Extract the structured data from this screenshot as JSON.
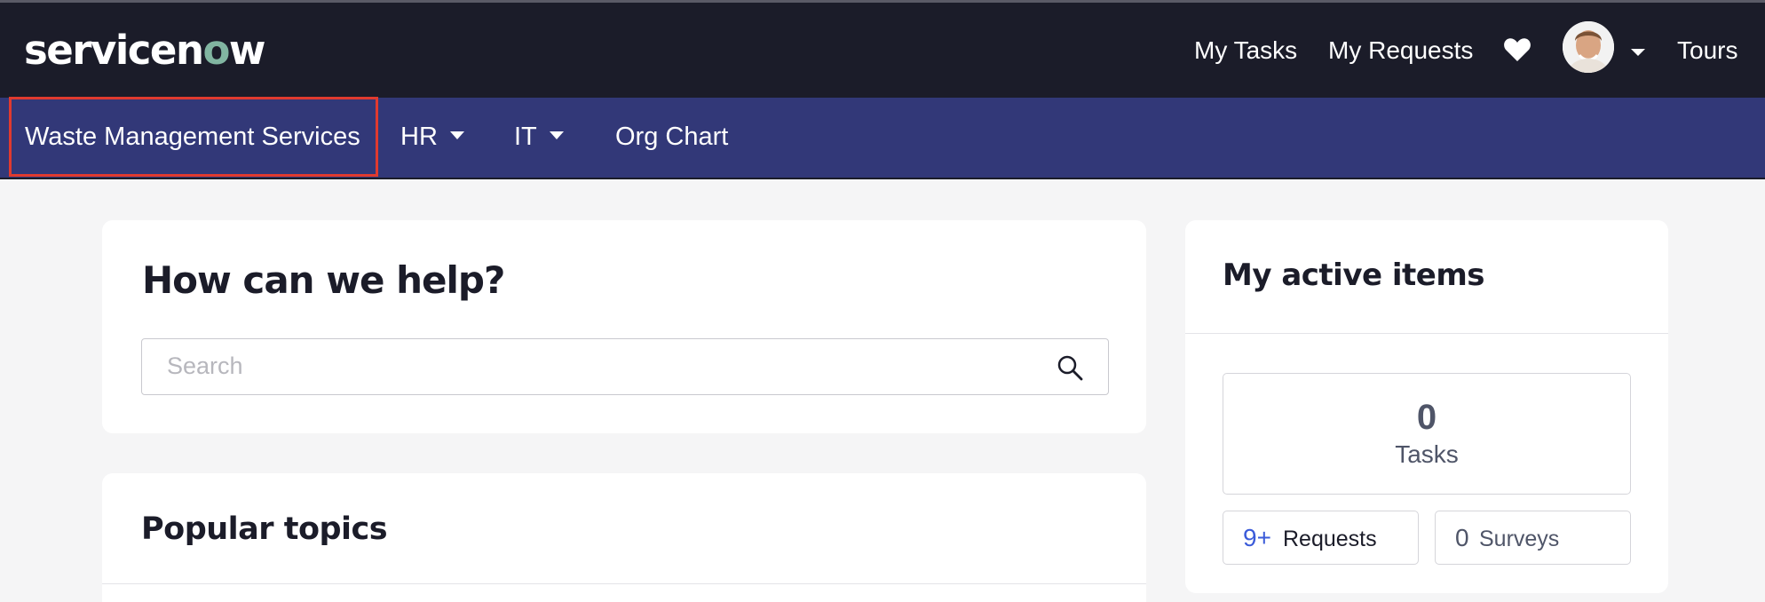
{
  "header": {
    "logo_text_a": "servicen",
    "logo_text_o": "o",
    "logo_text_b": "w",
    "nav": {
      "my_tasks": "My Tasks",
      "my_requests": "My Requests",
      "tours": "Tours"
    },
    "icons": {
      "favorites": "heart-icon",
      "avatar": "user-avatar",
      "menu": "caret-down-icon"
    }
  },
  "subnav": {
    "items": [
      {
        "label": "Waste Management Services"
      },
      {
        "label": "HR"
      },
      {
        "label": "IT"
      },
      {
        "label": "Org Chart"
      }
    ]
  },
  "help": {
    "title": "How can we help?",
    "search_placeholder": "Search"
  },
  "topics": {
    "title": "Popular topics"
  },
  "active_items": {
    "title": "My active items",
    "tasks_count": "0",
    "tasks_label": "Tasks",
    "requests_count": "9+",
    "requests_label": "Requests",
    "surveys_count": "0",
    "surveys_label": "Surveys"
  },
  "colors": {
    "header_bg": "#1b1c29",
    "subnav_bg": "#323878",
    "highlight": "#e03a2f",
    "link_blue": "#3b5bd9"
  }
}
